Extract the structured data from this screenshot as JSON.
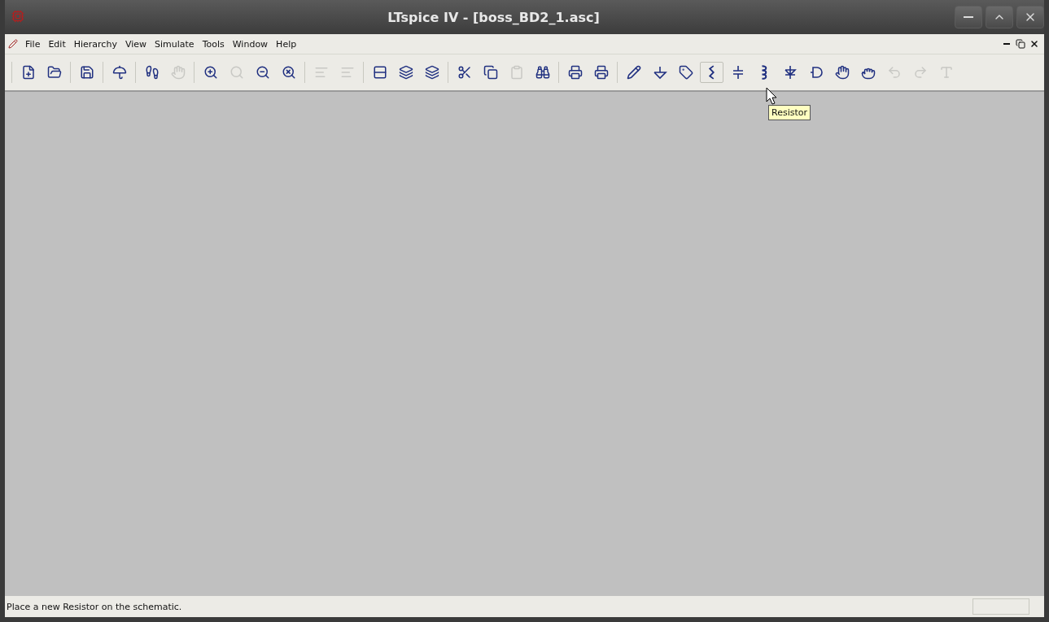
{
  "window": {
    "title": "LTspice IV - [boss_BD2_1.asc]"
  },
  "menu": [
    "File",
    "Edit",
    "Hierarchy",
    "View",
    "Simulate",
    "Tools",
    "Window",
    "Help"
  ],
  "toolbar": [
    [
      {
        "kind": "new",
        "disabled": false,
        "hovered": false
      },
      {
        "kind": "open",
        "disabled": false,
        "hovered": false
      }
    ],
    [
      {
        "kind": "save",
        "disabled": false,
        "hovered": false
      }
    ],
    [
      {
        "kind": "control",
        "disabled": false,
        "hovered": false
      }
    ],
    [
      {
        "kind": "run",
        "disabled": false,
        "hovered": false
      },
      {
        "kind": "halt",
        "disabled": true,
        "hovered": false
      }
    ],
    [
      {
        "kind": "zoomin",
        "disabled": false,
        "hovered": false
      },
      {
        "kind": "pan",
        "disabled": true,
        "hovered": false
      },
      {
        "kind": "zoomout",
        "disabled": false,
        "hovered": false
      },
      {
        "kind": "zoomfit",
        "disabled": false,
        "hovered": false
      }
    ],
    [
      {
        "kind": "list",
        "disabled": true,
        "hovered": false
      },
      {
        "kind": "list",
        "disabled": true,
        "hovered": false
      }
    ],
    [
      {
        "kind": "tile",
        "disabled": false,
        "hovered": false
      },
      {
        "kind": "cascade",
        "disabled": false,
        "hovered": false
      },
      {
        "kind": "cascade",
        "disabled": false,
        "hovered": false
      }
    ],
    [
      {
        "kind": "cut",
        "disabled": false,
        "hovered": false
      },
      {
        "kind": "copy",
        "disabled": false,
        "hovered": false
      },
      {
        "kind": "paste",
        "disabled": true,
        "hovered": false
      },
      {
        "kind": "find",
        "disabled": false,
        "hovered": false
      }
    ],
    [
      {
        "kind": "preview",
        "disabled": false,
        "hovered": false
      },
      {
        "kind": "print",
        "disabled": false,
        "hovered": false
      }
    ],
    [
      {
        "kind": "wire",
        "disabled": false,
        "hovered": false
      },
      {
        "kind": "ground",
        "disabled": false,
        "hovered": false
      },
      {
        "kind": "label",
        "disabled": false,
        "hovered": false
      },
      {
        "kind": "resistor",
        "disabled": false,
        "hovered": true
      },
      {
        "kind": "capacitor",
        "disabled": false,
        "hovered": false
      },
      {
        "kind": "inductor",
        "disabled": false,
        "hovered": false
      },
      {
        "kind": "diode",
        "disabled": false,
        "hovered": false
      },
      {
        "kind": "component",
        "disabled": false,
        "hovered": false
      },
      {
        "kind": "move",
        "disabled": false,
        "hovered": false
      },
      {
        "kind": "drag",
        "disabled": false,
        "hovered": false
      },
      {
        "kind": "undo",
        "disabled": true,
        "hovered": false
      },
      {
        "kind": "redo",
        "disabled": true,
        "hovered": false
      },
      {
        "kind": "text",
        "disabled": true,
        "hovered": false
      }
    ]
  ],
  "tooltip": "Resistor",
  "status_bar": "Place a new Resistor on the schematic."
}
